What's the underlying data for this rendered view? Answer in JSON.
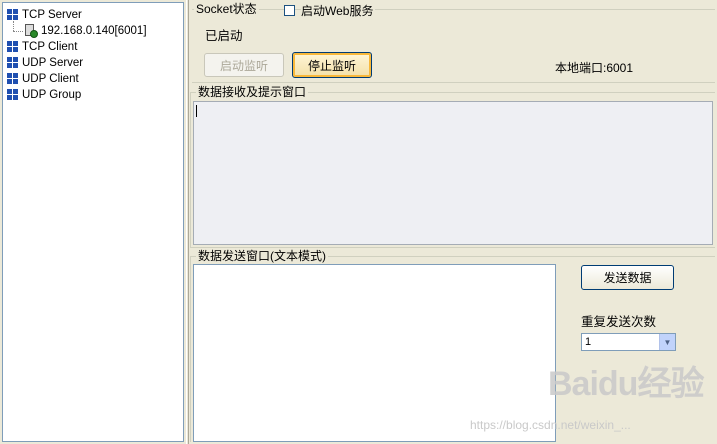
{
  "tree": {
    "items": [
      {
        "label": "TCP Server",
        "icon": "network-icon"
      },
      {
        "label": "192.168.0.140[6001]",
        "icon": "connection-icon"
      },
      {
        "label": "TCP Client",
        "icon": "network-icon"
      },
      {
        "label": "UDP Server",
        "icon": "network-icon"
      },
      {
        "label": "UDP Client",
        "icon": "network-icon"
      },
      {
        "label": "UDP Group",
        "icon": "network-icon"
      }
    ]
  },
  "socket_group": {
    "title": "Socket状态",
    "web_service_label": "启动Web服务",
    "web_service_checked": false,
    "status_text": "已启动",
    "start_listen_label": "启动监听",
    "stop_listen_label": "停止监听",
    "local_port_text": "本地端口:6001"
  },
  "receive_group": {
    "title": "数据接收及提示窗口",
    "content": ""
  },
  "send_group": {
    "title": "数据发送窗口(文本模式)",
    "content": "",
    "send_button_label": "发送数据",
    "repeat_label": "重复发送次数",
    "repeat_value": "1"
  },
  "colors": {
    "tree_icon": "#1f4fb0",
    "window_bg": "#ece9d8",
    "border": "#7f9db9"
  },
  "watermark": {
    "logo": "Baidu经验",
    "url": "https://blog.csdn.net/weixin_..."
  }
}
